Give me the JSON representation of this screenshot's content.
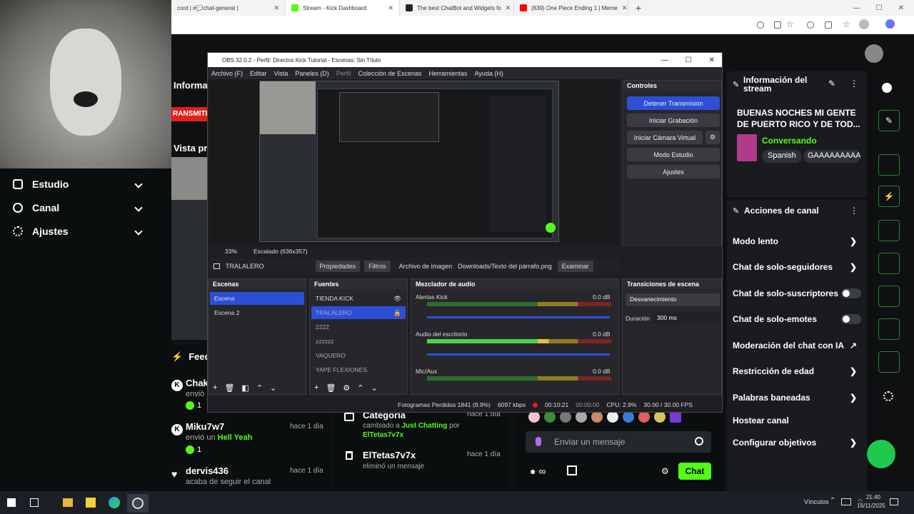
{
  "browser": {
    "tabs": [
      {
        "title": "cord | #💬chat-general |",
        "color": "#5865f2"
      },
      {
        "title": "Stream - Kick Dashboard",
        "color": "#53fc18"
      },
      {
        "title": "The best ChatBot and Widgets fo",
        "color": "#222222"
      },
      {
        "title": "(839) One Piece Ending 1 | Meme",
        "color": "#ff0000"
      }
    ],
    "new_tab": "+"
  },
  "kick": {
    "info_partial": "Informac",
    "transmit_partial": "RANSMITI",
    "preview_partial": "Vista pre",
    "feed_partial": "Feed de",
    "nav": [
      {
        "label": "Estudio"
      },
      {
        "label": "Canal"
      },
      {
        "label": "Ajustes"
      }
    ],
    "feed": [
      {
        "user": "Chaka",
        "text": "envió u",
        "count": "1"
      },
      {
        "user": "Miku7w7",
        "time": "hace 1 día",
        "text_prefix": "envió un",
        "text_highlight": "Hell Yeah",
        "count": "1"
      },
      {
        "user": "dervis436",
        "time": "hace 1 día",
        "text": "acaba de seguir el canal"
      }
    ],
    "events": [
      {
        "title": "Categoría",
        "time": "hace 1 día",
        "text_prefix": "cambiado a",
        "highlight": "Just Chatting",
        "text_mid": "por",
        "user": "ElTetas7v7x"
      },
      {
        "title": "ElTetas7v7x",
        "time": "hace 1 día",
        "text": "eliminó un mensaje"
      }
    ],
    "chat": {
      "placeholder": "Enviar un mensaje",
      "send": "Chat",
      "infinity": "∞"
    },
    "stream_info": {
      "title": "Información del stream",
      "stream_title": "BUENAS NOCHES MI GENTE DE PUERTO RICO Y DE TOD...",
      "category": "Conversando",
      "tags": [
        "Spanish",
        "GAAAAAAAAA"
      ]
    },
    "channel_actions": {
      "title": "Acciones de canal",
      "items": [
        {
          "label": "Modo lento",
          "kind": "arrow"
        },
        {
          "label": "Chat de solo-seguidores",
          "kind": "arrow"
        },
        {
          "label": "Chat de solo-suscriptores",
          "kind": "toggle"
        },
        {
          "label": "Chat de solo-emotes",
          "kind": "toggle"
        },
        {
          "label": "Moderación del chat con IA",
          "kind": "external"
        },
        {
          "label": "Restricción de edad",
          "kind": "arrow"
        },
        {
          "label": "Palabras baneadas",
          "kind": "arrow"
        },
        {
          "label": "Hostear canal",
          "kind": "none"
        },
        {
          "label": "Configurar objetivos",
          "kind": "arrow"
        }
      ]
    }
  },
  "obs": {
    "title": "OBS 32.0.2 - Perfil: Directos Kick Tutorial - Escenas: Sin Título",
    "menu": [
      "Archivo (F)",
      "Editar",
      "Vista",
      "Paneles (D)",
      "Perfil",
      "Colección de Escenas",
      "Herramientas",
      "Ayuda (H)"
    ],
    "zoom": "33%",
    "scaling": "Escalado (636x357)",
    "source_name": "TRALALERO",
    "properties": "Propiedades",
    "filters": "Filtros",
    "image_file_label": "Archivo de imagen",
    "image_path": "Downloads/Texto del párrafo.png",
    "browse": "Examinar",
    "controls": {
      "title": "Controles",
      "buttons": [
        "Detener Transmisión",
        "Iniciar Grabación",
        "Iniciar Cámara Virtual",
        "Modo Estudio",
        "Ajustes"
      ]
    },
    "scenes": {
      "title": "Escenas",
      "items": [
        "Escena",
        "Escena 2"
      ]
    },
    "sources": {
      "title": "Fuentes",
      "items": [
        "TIENDA KICK",
        "TRALALERO",
        "2222",
        "zzzzzz",
        "VAQUERO",
        "YAPE FLEXIONES"
      ]
    },
    "mixer": {
      "title": "Mezclador de audio",
      "channels": [
        {
          "name": "Alertas Kick",
          "db": "0.0 dB",
          "level": 0
        },
        {
          "name": "Audio del escritorio",
          "db": "0.0 dB",
          "level": 0.7
        },
        {
          "name": "Mic/Aux",
          "db": "0.0 dB",
          "level": 0.5
        }
      ],
      "ticks": [
        "-60",
        "-55",
        "-50",
        "-45",
        "-40",
        "-35",
        "-30",
        "-25",
        "-20",
        "-15",
        "-10",
        "-5",
        "0"
      ]
    },
    "transitions": {
      "title": "Transiciones de escena",
      "type": "Desvanecimiento",
      "duration_label": "Duración",
      "duration": "300 ms"
    },
    "status": {
      "dropped": "Fotogramas Perdidos 1841 (9.9%)",
      "kbps": "6097 kbps",
      "live": "00:10:21",
      "rec": "00:00:00",
      "cpu": "CPU: 2.9%",
      "fps": "30.00 / 30.00 FPS"
    }
  },
  "taskbar": {
    "links": "Vínculos",
    "time": "21:40",
    "date": "16/11/2025"
  },
  "colors": {
    "kick_green": "#53fc18",
    "obs_blue": "#2c4fd6",
    "live_red": "#e02020"
  }
}
